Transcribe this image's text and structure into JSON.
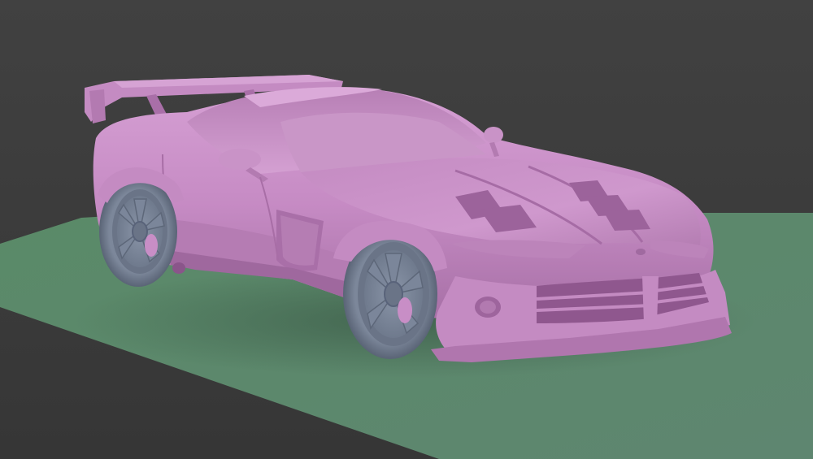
{
  "scene": {
    "background_color": "#3b3b3b",
    "ground_color": "#5e8a6e",
    "body_color": "#c98ec7",
    "body_shadow_color": "#9d6a9c",
    "body_highlight_color": "#dcabd9",
    "wheel_color": "#7f8a9d",
    "wheel_shadow_color": "#5b6577",
    "subject": "car-model-clay-render"
  }
}
